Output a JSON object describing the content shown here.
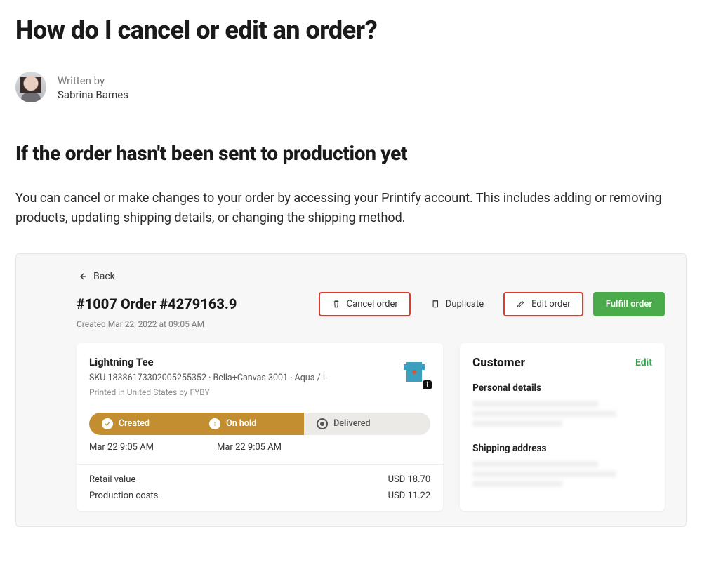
{
  "article": {
    "title": "How do I cancel or edit an order?",
    "written_by_label": "Written by",
    "author": "Sabrina Barnes",
    "section_heading": "If the order hasn't been sent to production yet",
    "paragraph": "You can cancel or make changes to your order by accessing your Printify account. This includes adding or removing products, updating shipping details, or changing the shipping method."
  },
  "order_ui": {
    "back": "Back",
    "title": "#1007 Order #4279163.9",
    "created_meta": "Created Mar 22, 2022 at 09:05 AM",
    "actions": {
      "cancel": "Cancel order",
      "duplicate": "Duplicate",
      "edit": "Edit order",
      "fulfill": "Fulfill order"
    },
    "product": {
      "name": "Lightning Tee",
      "sku_line": "SKU 18386173302005255352  · Bella+Canvas 3001 · Aqua / L",
      "printed": "Printed in United States by FYBY",
      "qty": "1"
    },
    "status": {
      "created": "Created",
      "onhold": "On hold",
      "delivered": "Delivered",
      "time1": "Mar 22 9:05 AM",
      "time2": "Mar 22 9:05 AM"
    },
    "money": {
      "retail_label": "Retail value",
      "retail_value": "USD 18.70",
      "prod_label": "Production costs",
      "prod_value": "USD 11.22"
    },
    "customer": {
      "title": "Customer",
      "edit": "Edit",
      "personal": "Personal details",
      "shipping": "Shipping address"
    }
  }
}
